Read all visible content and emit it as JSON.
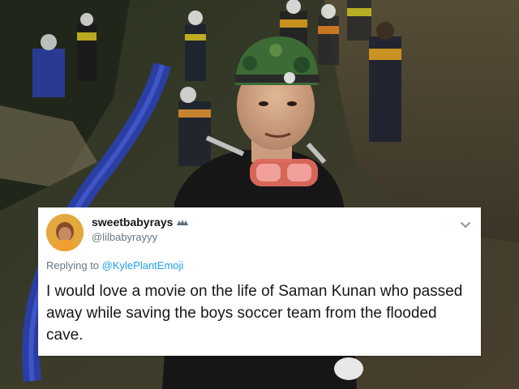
{
  "tweet": {
    "display_name": "sweetbabyrays",
    "handle": "@lilbabyrayyy",
    "reply_prefix": "Replying to",
    "reply_to": "@KylePlantEmoji",
    "text": "I would love a movie on the life of Saman Kunan who passed away while saving the boys soccer team from the flooded cave.",
    "icons": {
      "avatar": "profile-photo",
      "name_badge": "small-emoji-badge",
      "menu": "chevron-down-icon"
    },
    "colors": {
      "card_background": "#ffffff",
      "name": "#14171a",
      "secondary": "#657786",
      "link": "#1da1f2"
    }
  },
  "background": {
    "description_icon": "cave-rescue-photo"
  }
}
